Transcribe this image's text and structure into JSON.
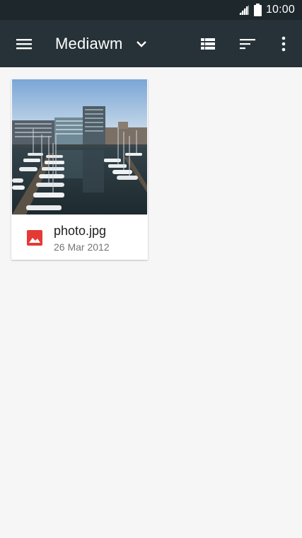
{
  "status_bar": {
    "time": "10:00",
    "icons": [
      "signal-icon",
      "battery-icon"
    ]
  },
  "toolbar": {
    "title": "Mediawm",
    "menu_icon": "menu-icon",
    "dropdown_icon": "chevron-down-icon",
    "view_icon": "list-view-icon",
    "sort_icon": "sort-icon",
    "more_icon": "more-vert-icon"
  },
  "files": [
    {
      "name": "photo.jpg",
      "date": "26 Mar 2012",
      "type_icon": "image-icon"
    }
  ],
  "colors": {
    "status_bar": "#1d272c",
    "toolbar": "#263238",
    "background": "#f6f6f6",
    "image_icon": "#e53935"
  }
}
